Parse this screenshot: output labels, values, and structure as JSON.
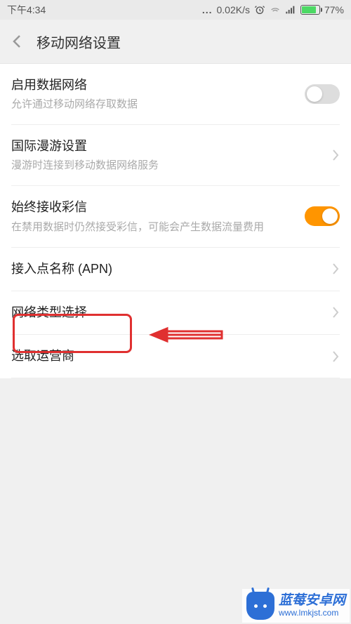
{
  "status": {
    "time": "下午4:34",
    "speed": "0.02K/s",
    "battery_pct": "77%"
  },
  "header": {
    "title": "移动网络设置"
  },
  "items": {
    "data": {
      "title": "启用数据网络",
      "sub": "允许通过移动网络存取数据"
    },
    "roaming": {
      "title": "国际漫游设置",
      "sub": "漫游时连接到移动数据网络服务"
    },
    "mms": {
      "title": "始终接收彩信",
      "sub": "在禁用数据时仍然接受彩信，可能会产生数据流量费用"
    },
    "apn": {
      "title": "接入点名称 (APN)"
    },
    "nettype": {
      "title": "网络类型选择"
    },
    "carrier": {
      "title": "选取运营商"
    }
  },
  "watermark": {
    "title": "蓝莓安卓网",
    "url": "www.lmkjst.com"
  }
}
